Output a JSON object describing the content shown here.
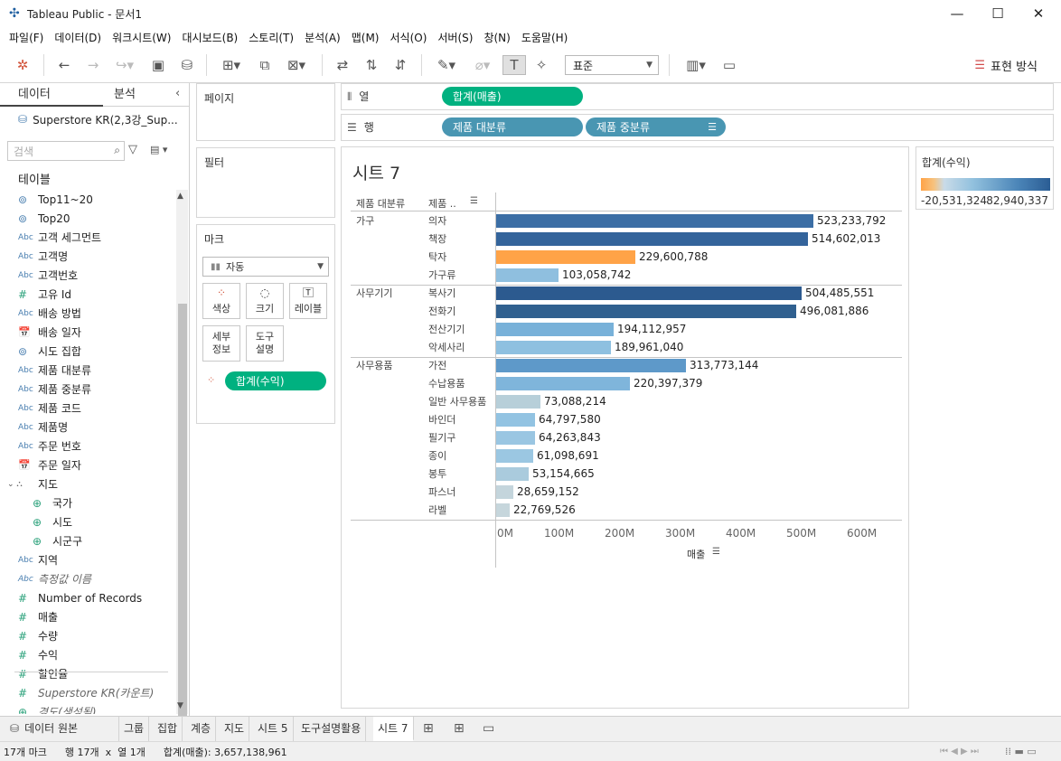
{
  "window": {
    "title": "Tableau Public - 문서1"
  },
  "menu": [
    "파일(F)",
    "데이터(D)",
    "워크시트(W)",
    "대시보드(B)",
    "스토리(T)",
    "분석(A)",
    "맵(M)",
    "서식(O)",
    "서버(S)",
    "창(N)",
    "도움말(H)"
  ],
  "toolbar": {
    "fit_select": "표준",
    "show_me_label": "표현 방식"
  },
  "data_pane": {
    "tab_data": "데이터",
    "tab_analysis": "분석",
    "source": "Superstore KR(2,3강_Sup...",
    "search_placeholder": "검색",
    "tables_header": "테이블",
    "fields": [
      {
        "icon": "set",
        "name": "Top11~20"
      },
      {
        "icon": "set",
        "name": "Top20"
      },
      {
        "icon": "Abc",
        "name": "고객 세그먼트"
      },
      {
        "icon": "Abc",
        "name": "고객명"
      },
      {
        "icon": "Abc",
        "name": "고객번호"
      },
      {
        "icon": "#",
        "name": "고유 Id"
      },
      {
        "icon": "Abc",
        "name": "배송 방법"
      },
      {
        "icon": "date",
        "name": "배송 일자"
      },
      {
        "icon": "set",
        "name": "시도 집합"
      },
      {
        "icon": "Abc",
        "name": "제품 대분류"
      },
      {
        "icon": "Abc",
        "name": "제품 중분류"
      },
      {
        "icon": "Abc",
        "name": "제품 코드"
      },
      {
        "icon": "Abc",
        "name": "제품명"
      },
      {
        "icon": "Abc",
        "name": "주문 번호"
      },
      {
        "icon": "date",
        "name": "주문 일자"
      },
      {
        "icon": "folder",
        "name": "지도"
      },
      {
        "icon": "geo",
        "name": "국가",
        "indent": true
      },
      {
        "icon": "geo",
        "name": "시도",
        "indent": true
      },
      {
        "icon": "geo",
        "name": "시군구",
        "indent": true
      },
      {
        "icon": "Abc",
        "name": "지역"
      },
      {
        "icon": "Abc",
        "name": "측정값 이름",
        "italic": true
      },
      {
        "icon": "#",
        "name": "Number of Records"
      },
      {
        "icon": "#",
        "name": "매출"
      },
      {
        "icon": "#",
        "name": "수량"
      },
      {
        "icon": "#",
        "name": "수익"
      },
      {
        "icon": "#",
        "name": "할인율"
      },
      {
        "icon": "#",
        "name": "Superstore KR(카운트)",
        "italic": true
      },
      {
        "icon": "geo",
        "name": "경도(생성됨)",
        "italic": true
      }
    ]
  },
  "shelves": {
    "pages": "페이지",
    "filters": "필터",
    "marks": "마크",
    "mark_type": "자동",
    "mark_buttons": [
      "색상",
      "크기",
      "레이블",
      "세부\n정보",
      "도구\n설명"
    ],
    "color_pill": "합계(수익)",
    "columns_label": "열",
    "rows_label": "행",
    "columns_pill": "합계(매출)",
    "rows_pills": [
      "제품 대분류",
      "제품 중분류"
    ]
  },
  "view": {
    "sheet_title": "시트 7",
    "header_category": "제품 대분류",
    "header_subcategory": "제품 ..",
    "axis_title": "매출"
  },
  "legend": {
    "title": "합계(수익)",
    "min": "-20,531,324",
    "max": "82,940,337",
    "colors": [
      "#ffa347",
      "#c9dbe8",
      "#92c1de",
      "#4b85b8",
      "#2b5d94"
    ]
  },
  "chart_data": {
    "type": "bar",
    "orientation": "horizontal",
    "xlabel": "매출",
    "xlim": [
      0,
      600000000
    ],
    "xticks": [
      "0M",
      "100M",
      "200M",
      "300M",
      "400M",
      "500M",
      "600M"
    ],
    "groups": [
      {
        "category": "가구",
        "items": [
          {
            "name": "의자",
            "value": 523233792,
            "label": "523,233,792",
            "color": "#3b6ea5"
          },
          {
            "name": "책장",
            "value": 514602013,
            "label": "514,602,013",
            "color": "#34649b"
          },
          {
            "name": "탁자",
            "value": 229600788,
            "label": "229,600,788",
            "color": "#ffa347"
          },
          {
            "name": "가구류",
            "value": 103058742,
            "label": "103,058,742",
            "color": "#8fbfdf"
          }
        ]
      },
      {
        "category": "사무기기",
        "items": [
          {
            "name": "복사기",
            "value": 504485551,
            "label": "504,485,551",
            "color": "#2c5a8f"
          },
          {
            "name": "전화기",
            "value": 496081886,
            "label": "496,081,886",
            "color": "#30608f"
          },
          {
            "name": "전산기기",
            "value": 194112957,
            "label": "194,112,957",
            "color": "#78b1d9"
          },
          {
            "name": "악세사리",
            "value": 189961040,
            "label": "189,961,040",
            "color": "#8ec0e0"
          }
        ]
      },
      {
        "category": "사무용품",
        "items": [
          {
            "name": "가전",
            "value": 313773144,
            "label": "313,773,144",
            "color": "#5e99c9"
          },
          {
            "name": "수납용품",
            "value": 220397379,
            "label": "220,397,379",
            "color": "#7fb5db"
          },
          {
            "name": "일반 사무용품",
            "value": 73088214,
            "label": "73,088,214",
            "color": "#b7cfd9"
          },
          {
            "name": "바인더",
            "value": 64797580,
            "label": "64,797,580",
            "color": "#92c3e2"
          },
          {
            "name": "필기구",
            "value": 64263843,
            "label": "64,263,843",
            "color": "#9ac6e2"
          },
          {
            "name": "종이",
            "value": 61098691,
            "label": "61,098,691",
            "color": "#9bc7e2"
          },
          {
            "name": "봉투",
            "value": 53154665,
            "label": "53,154,665",
            "color": "#aacbdd"
          },
          {
            "name": "파스너",
            "value": 28659152,
            "label": "28,659,152",
            "color": "#c4d5dc"
          },
          {
            "name": "라벨",
            "value": 22769526,
            "label": "22,769,526",
            "color": "#c6d6dc"
          }
        ]
      }
    ]
  },
  "sheet_tabs": [
    "데이터 원본",
    "그룹",
    "집합",
    "계층",
    "지도",
    "시트 5",
    "도구설명활용",
    "시트 7"
  ],
  "status": {
    "marks": "17개 마크",
    "rows_cols": "행 17개  x  열 1개",
    "sum": "합계(매출): 3,657,138,961"
  }
}
